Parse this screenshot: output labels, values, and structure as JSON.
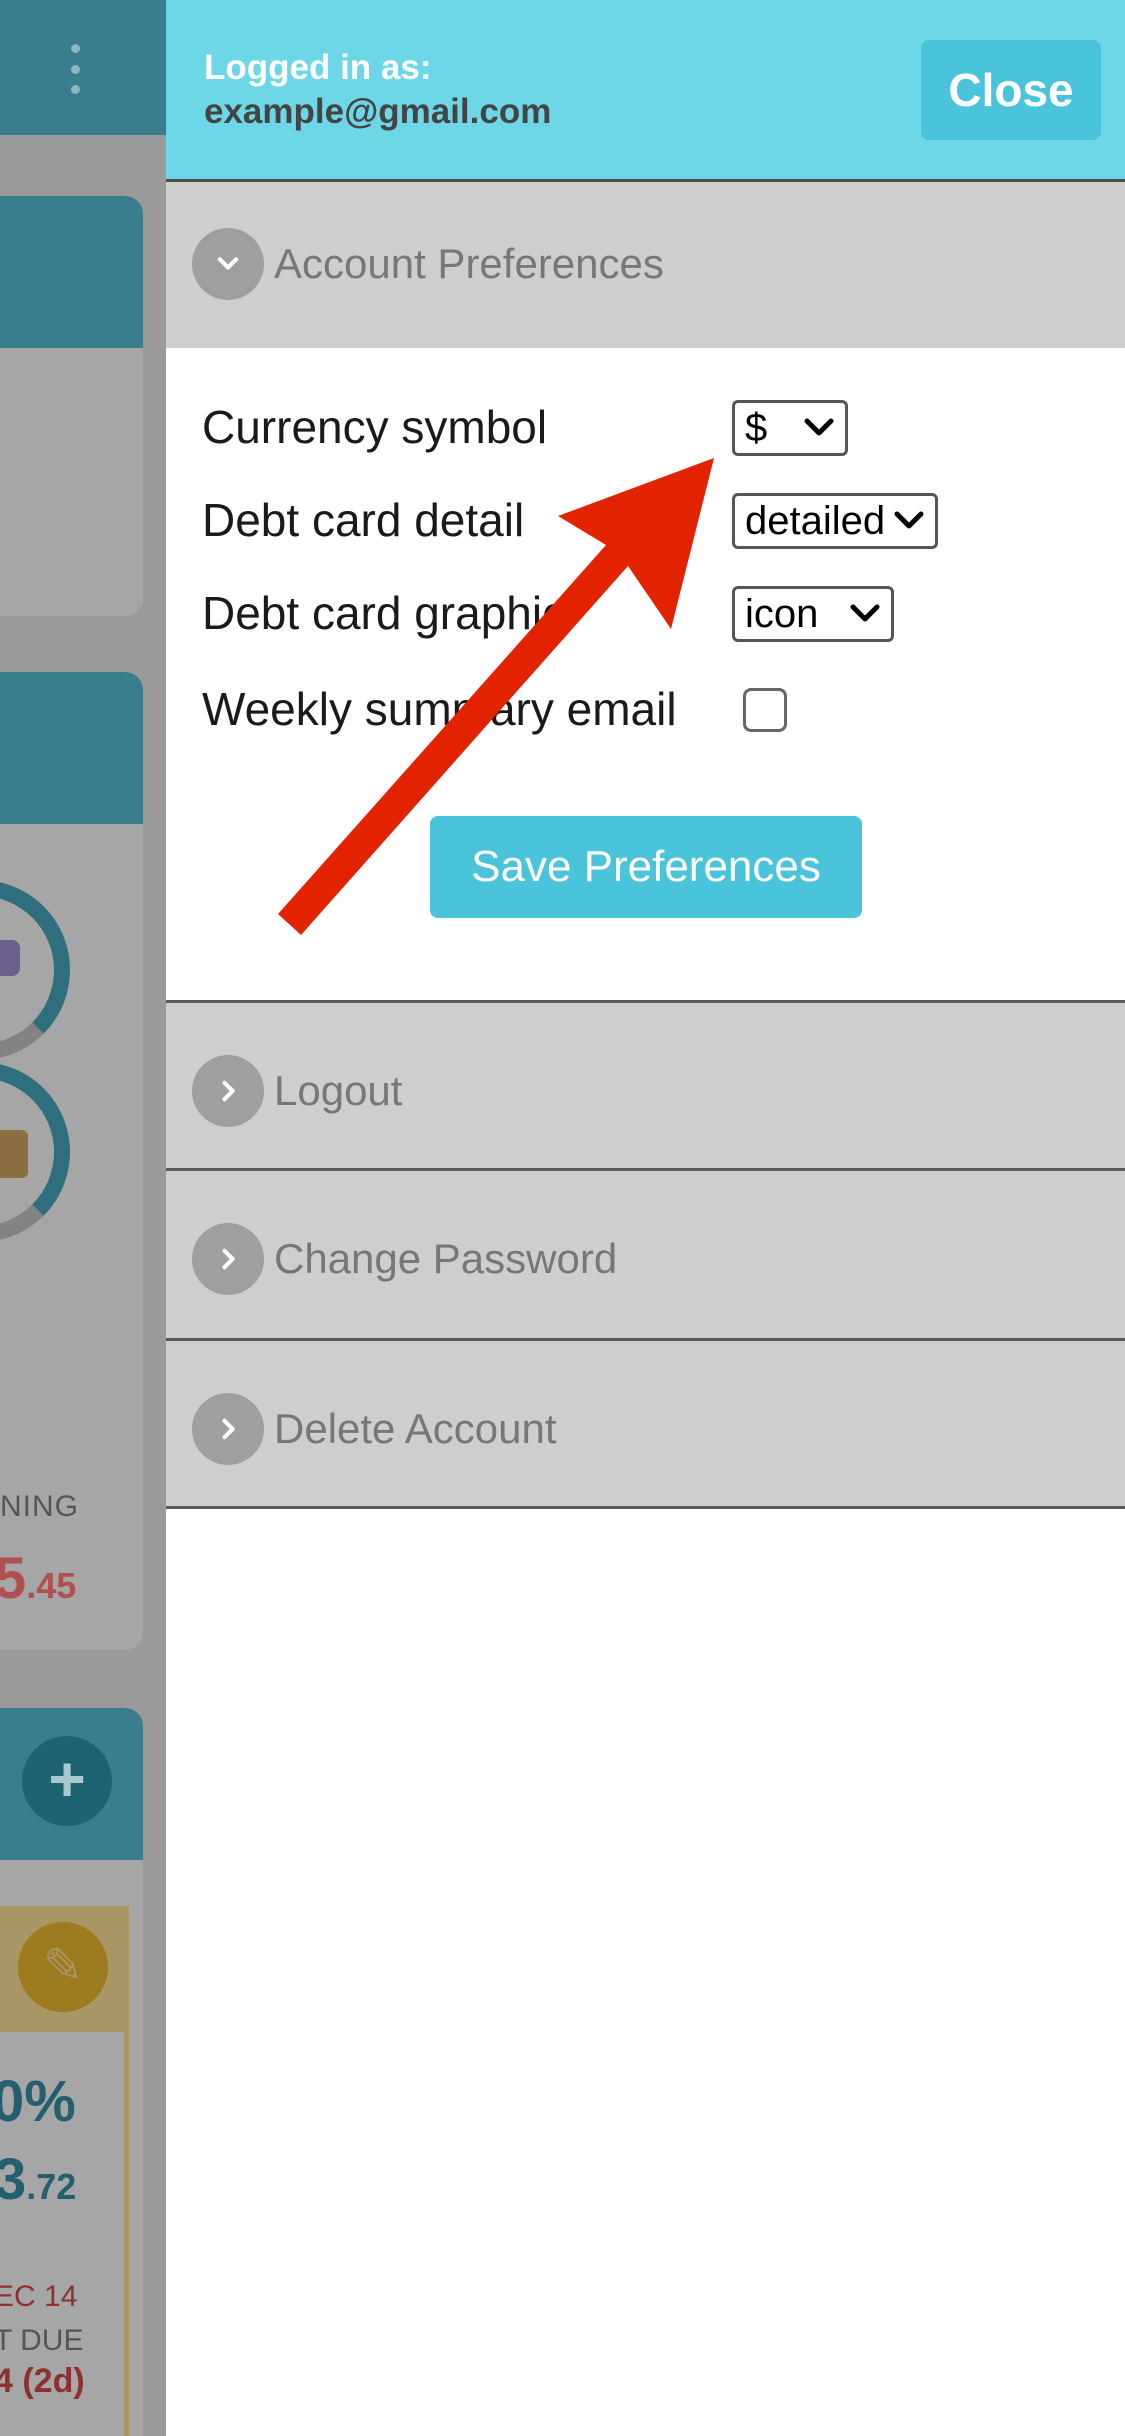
{
  "background_app": {
    "remaining_label": "NING",
    "remaining_amount_big": "5",
    "remaining_amount_small": ".45",
    "add_icon": "+",
    "edit_icon": "✎",
    "percent": "0%",
    "amount_big": "3",
    "amount_small": ".72",
    "date": "EC 14",
    "due_label": "T DUE",
    "days": "4 (2d)"
  },
  "panel": {
    "login_label": "Logged in as:",
    "login_email": "example@gmail.com",
    "close_label": "Close",
    "sections": {
      "account_preferences": "Account Preferences",
      "logout": "Logout",
      "change_password": "Change Password",
      "delete_account": "Delete Account"
    },
    "preferences": {
      "currency_label": "Currency symbol",
      "currency_value": "$",
      "debt_detail_label": "Debt card detail",
      "debt_detail_value": "detailed",
      "debt_graphic_label": "Debt card graphic",
      "debt_graphic_value": "icon",
      "weekly_email_label": "Weekly summary email",
      "weekly_email_checked": false,
      "save_label": "Save Preferences"
    }
  },
  "colors": {
    "header_bg": "#6dd7e8",
    "button_bg": "#4ac4da",
    "section_bg": "#cecece",
    "annotation_arrow": "#e32200"
  }
}
